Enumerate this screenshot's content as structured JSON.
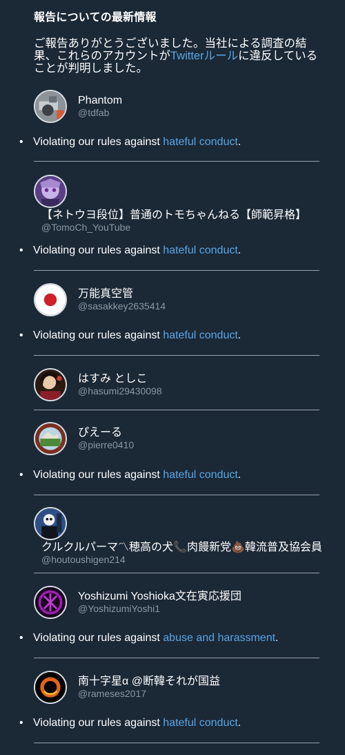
{
  "header": {
    "title": "報告についての最新情報"
  },
  "intro": {
    "before": "ご報告ありがとうございました。当社による調査の結果、これらのアカウントが",
    "link": "Twitterルール",
    "after": "に違反していることが判明しました。"
  },
  "violation_prefix": "Violating our rules against ",
  "violation_suffix": ".",
  "accounts": [
    {
      "name": "Phantom",
      "handle": "@tdfab",
      "avatar_icon": "camera-avatar-icon",
      "violation_link": "hateful conduct"
    },
    {
      "name": "【ネトウヨ段位】普通のトモちゃんねる【師範昇格】",
      "handle": "@TomoCh_YouTube",
      "avatar_icon": "anime-girl-avatar-icon",
      "violation_link": "hateful conduct"
    },
    {
      "name": "万能真空管",
      "handle": "@sasakkey2635414",
      "avatar_icon": "japan-flag-avatar-icon",
      "violation_link": "hateful conduct"
    },
    {
      "name": "はすみ としこ",
      "handle": "@hasumi29430098",
      "avatar_icon": "portrait-avatar-icon",
      "violation_link": ""
    },
    {
      "name": "ぴえーる",
      "handle": "@pierre0410",
      "avatar_icon": "round-badge-avatar-icon",
      "violation_link": "hateful conduct"
    },
    {
      "name": "クルクルパーマ〽穂高の犬📞肉饅新党💩韓流普及協会員",
      "handle": "@houtoushigen214",
      "avatar_icon": "costume-avatar-icon",
      "violation_link": ""
    },
    {
      "name": "Yoshizumi Yoshioka文在寅応援団",
      "handle": "@YoshizumiYoshi1",
      "avatar_icon": "purple-emblem-avatar-icon",
      "violation_link": "abuse and harassment"
    },
    {
      "name": "南十字星α @断韓それが国益",
      "handle": "@rameses2017",
      "avatar_icon": "black-hole-avatar-icon",
      "violation_link": "hateful conduct"
    }
  ],
  "colors": {
    "background": "#1b2836",
    "link": "#5aa7e6",
    "handle": "#8899a6",
    "divider": "#9aa5b0"
  }
}
